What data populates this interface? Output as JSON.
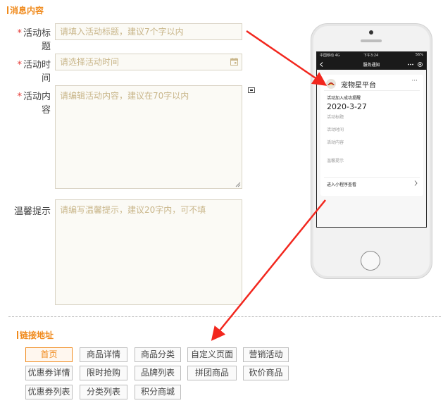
{
  "message_section": {
    "title": "消息内容",
    "required_mark": "*",
    "activity_title": {
      "label": "活动标题",
      "placeholder": "请填入活动标题，建议7个字以内"
    },
    "activity_time": {
      "label": "活动时间",
      "placeholder": "请选择活动时间"
    },
    "activity_content": {
      "label": "活动内容",
      "placeholder": "请编辑活动内容，建议在70字以内"
    },
    "warm_tip": {
      "label": "温馨提示",
      "placeholder": "请编写温馨提示，建议20字内，可不填"
    }
  },
  "phone": {
    "status_left": "中国移动 4G",
    "status_time": "下午3:24",
    "status_right": "56%",
    "nav_title": "服务通知",
    "card": {
      "app_name": "宠物星平台",
      "more": "···",
      "heading": "活动加入成功提醒",
      "date": "2020-3-27",
      "fields": [
        "活动标题",
        "活动时间",
        "活动内容",
        "温馨提示"
      ],
      "footer": "进入小程序查看"
    }
  },
  "link_section": {
    "title": "链接地址",
    "active_index": 0,
    "buttons": [
      "首页",
      "商品详情",
      "商品分类",
      "自定义页面",
      "营销活动",
      "优惠券详情",
      "限时抢购",
      "品牌列表",
      "拼团商品",
      "砍价商品",
      "优惠券列表",
      "分类列表",
      "积分商城"
    ]
  },
  "colors": {
    "accent": "#f08a1c",
    "required": "#e53935",
    "arrow": "#f2271e",
    "placeholder": "#c9b68a"
  },
  "icons": [
    "calendar-icon",
    "emoji-icon",
    "resize-handle-icon",
    "back-chevron-icon",
    "more-dots-icon",
    "target-icon",
    "pet-logo-icon",
    "chevron-right-icon"
  ]
}
